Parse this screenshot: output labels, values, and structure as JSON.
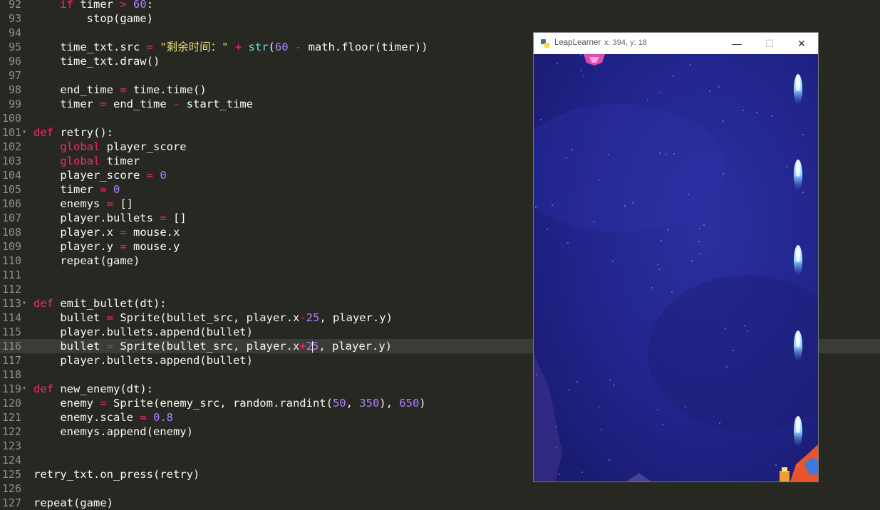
{
  "editor": {
    "lines": [
      {
        "n": "92",
        "fold": "",
        "code": [
          [
            "    ",
            ""
          ],
          [
            "if",
            "kw"
          ],
          [
            " timer ",
            ""
          ],
          [
            ">",
            "op"
          ],
          [
            " ",
            ""
          ],
          [
            "60",
            "num"
          ],
          [
            ":",
            ""
          ]
        ]
      },
      {
        "n": "93",
        "fold": "",
        "code": [
          [
            "        stop(game)",
            ""
          ]
        ]
      },
      {
        "n": "94",
        "fold": "",
        "code": []
      },
      {
        "n": "95",
        "fold": "",
        "code": [
          [
            "    time_txt.src ",
            ""
          ],
          [
            "=",
            "op"
          ],
          [
            " ",
            ""
          ],
          [
            "\"剩余时间：\"",
            "str"
          ],
          [
            " ",
            ""
          ],
          [
            "+",
            "op"
          ],
          [
            " ",
            ""
          ],
          [
            "str",
            "bi"
          ],
          [
            "(",
            ""
          ],
          [
            "60",
            "num"
          ],
          [
            " ",
            ""
          ],
          [
            "-",
            "op"
          ],
          [
            " math.floor(timer))",
            ""
          ]
        ]
      },
      {
        "n": "96",
        "fold": "",
        "code": [
          [
            "    time_txt.draw()",
            ""
          ]
        ]
      },
      {
        "n": "97",
        "fold": "",
        "code": []
      },
      {
        "n": "98",
        "fold": "",
        "code": [
          [
            "    end_time ",
            ""
          ],
          [
            "=",
            "op"
          ],
          [
            " time.time()",
            ""
          ]
        ]
      },
      {
        "n": "99",
        "fold": "",
        "code": [
          [
            "    timer ",
            ""
          ],
          [
            "=",
            "op"
          ],
          [
            " end_time ",
            ""
          ],
          [
            "-",
            "op"
          ],
          [
            " start_time",
            ""
          ]
        ]
      },
      {
        "n": "100",
        "fold": "",
        "code": []
      },
      {
        "n": "101",
        "fold": "▾",
        "code": [
          [
            "def",
            "df"
          ],
          [
            " retry():",
            ""
          ]
        ]
      },
      {
        "n": "102",
        "fold": "",
        "code": [
          [
            "    ",
            ""
          ],
          [
            "global",
            "kw"
          ],
          [
            " player_score",
            ""
          ]
        ]
      },
      {
        "n": "103",
        "fold": "",
        "code": [
          [
            "    ",
            ""
          ],
          [
            "global",
            "kw"
          ],
          [
            " timer",
            ""
          ]
        ]
      },
      {
        "n": "104",
        "fold": "",
        "code": [
          [
            "    player_score ",
            ""
          ],
          [
            "=",
            "op"
          ],
          [
            " ",
            ""
          ],
          [
            "0",
            "num"
          ]
        ]
      },
      {
        "n": "105",
        "fold": "",
        "code": [
          [
            "    timer ",
            ""
          ],
          [
            "=",
            "op"
          ],
          [
            " ",
            ""
          ],
          [
            "0",
            "num"
          ]
        ]
      },
      {
        "n": "106",
        "fold": "",
        "code": [
          [
            "    enemys ",
            ""
          ],
          [
            "=",
            "op"
          ],
          [
            " []",
            ""
          ]
        ]
      },
      {
        "n": "107",
        "fold": "",
        "code": [
          [
            "    player.bullets ",
            ""
          ],
          [
            "=",
            "op"
          ],
          [
            " []",
            ""
          ]
        ]
      },
      {
        "n": "108",
        "fold": "",
        "code": [
          [
            "    player.x ",
            ""
          ],
          [
            "=",
            "op"
          ],
          [
            " mouse.x",
            ""
          ]
        ]
      },
      {
        "n": "109",
        "fold": "",
        "code": [
          [
            "    player.y ",
            ""
          ],
          [
            "=",
            "op"
          ],
          [
            " mouse.y",
            ""
          ]
        ]
      },
      {
        "n": "110",
        "fold": "",
        "code": [
          [
            "    repeat(game)",
            ""
          ]
        ]
      },
      {
        "n": "111",
        "fold": "",
        "code": []
      },
      {
        "n": "112",
        "fold": "",
        "code": []
      },
      {
        "n": "113",
        "fold": "▾",
        "code": [
          [
            "def",
            "df"
          ],
          [
            " emit_bullet(dt):",
            ""
          ]
        ]
      },
      {
        "n": "114",
        "fold": "",
        "code": [
          [
            "    bullet ",
            ""
          ],
          [
            "=",
            "op"
          ],
          [
            " Sprite(bullet_src, player.x",
            ""
          ],
          [
            "-",
            "op"
          ],
          [
            "25",
            "num"
          ],
          [
            ", player.y)",
            ""
          ]
        ]
      },
      {
        "n": "115",
        "fold": "",
        "code": [
          [
            "    player.bullets.append(bullet)",
            ""
          ]
        ]
      },
      {
        "n": "116",
        "fold": "",
        "current": true,
        "code": [
          [
            "    bullet ",
            ""
          ],
          [
            "=",
            "op"
          ],
          [
            " Sprite(bullet_src, player.x",
            ""
          ],
          [
            "+",
            "op"
          ],
          [
            "2",
            "num"
          ],
          [
            "|",
            "caret"
          ],
          [
            "5",
            "num"
          ],
          [
            ", player.y)",
            ""
          ]
        ]
      },
      {
        "n": "117",
        "fold": "",
        "code": [
          [
            "    player.bullets.append(bullet)",
            ""
          ]
        ]
      },
      {
        "n": "118",
        "fold": "",
        "code": []
      },
      {
        "n": "119",
        "fold": "▾",
        "code": [
          [
            "def",
            "df"
          ],
          [
            " new_enemy(dt):",
            ""
          ]
        ]
      },
      {
        "n": "120",
        "fold": "",
        "code": [
          [
            "    enemy ",
            ""
          ],
          [
            "=",
            "op"
          ],
          [
            " Sprite(enemy_src, random.randint(",
            ""
          ],
          [
            "50",
            "num"
          ],
          [
            ", ",
            ""
          ],
          [
            "350",
            "num"
          ],
          [
            "), ",
            ""
          ],
          [
            "650",
            "num"
          ],
          [
            ")",
            ""
          ]
        ]
      },
      {
        "n": "121",
        "fold": "",
        "code": [
          [
            "    enemy.scale ",
            ""
          ],
          [
            "=",
            "op"
          ],
          [
            " ",
            ""
          ],
          [
            "0.8",
            "num"
          ]
        ]
      },
      {
        "n": "122",
        "fold": "",
        "code": [
          [
            "    enemys.append(enemy)",
            ""
          ]
        ]
      },
      {
        "n": "123",
        "fold": "",
        "code": []
      },
      {
        "n": "124",
        "fold": "",
        "code": []
      },
      {
        "n": "125",
        "fold": "",
        "code": [
          [
            "retry_txt.on_press(retry)",
            ""
          ]
        ]
      },
      {
        "n": "126",
        "fold": "",
        "code": []
      },
      {
        "n": "127",
        "fold": "",
        "code": [
          [
            "repeat(game)",
            ""
          ]
        ]
      }
    ]
  },
  "game_window": {
    "title": "LeapLearner",
    "coords": "x: 394, y: 18",
    "minimize_label": "—",
    "maximize_label": "☐",
    "close_label": "✕",
    "icon": "python-icon"
  },
  "game": {
    "bullets_count_visible": 5,
    "colors": {
      "background": "#1e2180",
      "bullet": "#8fd8ff",
      "player": "#e8552a",
      "enemy": "#d84fb0"
    }
  }
}
